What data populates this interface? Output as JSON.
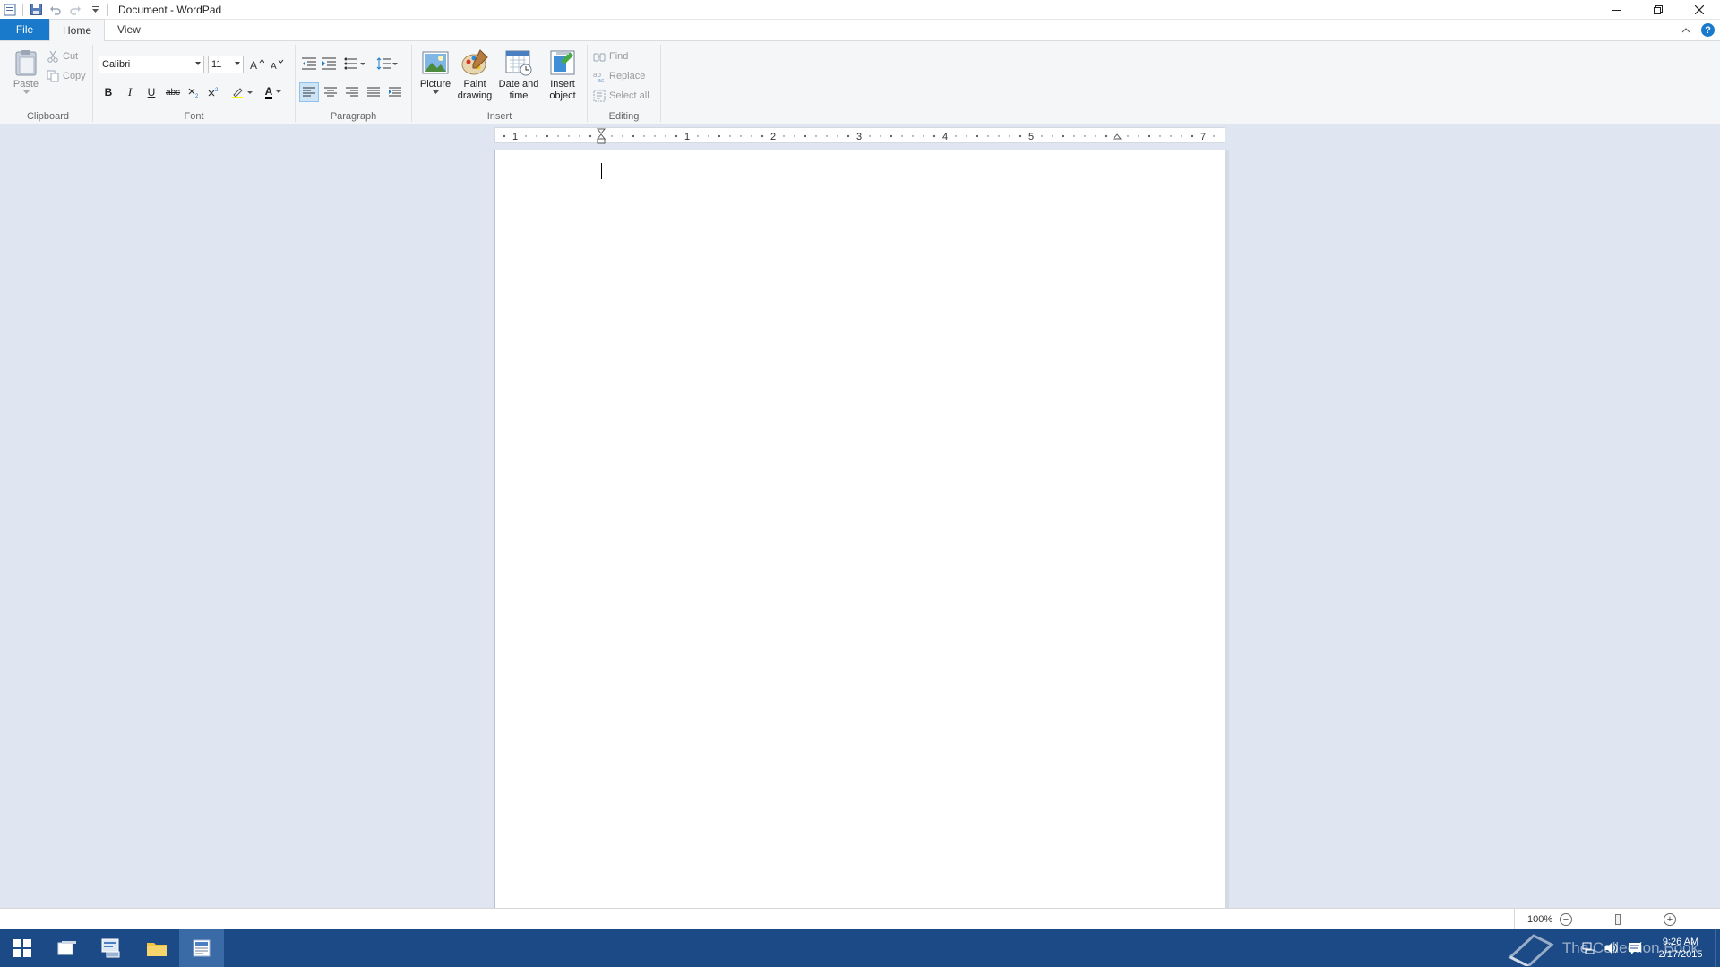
{
  "window": {
    "title": "Document - WordPad"
  },
  "tabs": [
    {
      "label": "File"
    },
    {
      "label": "Home"
    },
    {
      "label": "View"
    }
  ],
  "ribbon": {
    "clipboard": {
      "group_label": "Clipboard",
      "paste_label": "Paste",
      "cut_label": "Cut",
      "copy_label": "Copy"
    },
    "font": {
      "group_label": "Font",
      "family": "Calibri",
      "size": "11",
      "bold": "B",
      "italic": "I",
      "underline": "U",
      "strike": "abc",
      "font_color_letter": "A"
    },
    "paragraph": {
      "group_label": "Paragraph"
    },
    "insert": {
      "group_label": "Insert",
      "picture": "Picture",
      "paint_line1": "Paint",
      "paint_line2": "drawing",
      "datetime_line1": "Date and",
      "datetime_line2": "time",
      "object_line1": "Insert",
      "object_line2": "object"
    },
    "editing": {
      "group_label": "Editing",
      "find": "Find",
      "replace": "Replace",
      "select_all": "Select all"
    }
  },
  "ruler": {
    "numbers": [
      "1",
      "1",
      "2",
      "3",
      "4",
      "5",
      "7"
    ]
  },
  "statusbar": {
    "zoom_level": "100%",
    "zoom_fraction": 0.5
  },
  "taskbar": {
    "watermark": "The Collection Book",
    "clock_time": "9:26 AM",
    "clock_date": "2/17/2015"
  },
  "colors": {
    "accent": "#1979ca",
    "taskbar": "#1c4a86",
    "workspace": "#dfe6f1"
  }
}
